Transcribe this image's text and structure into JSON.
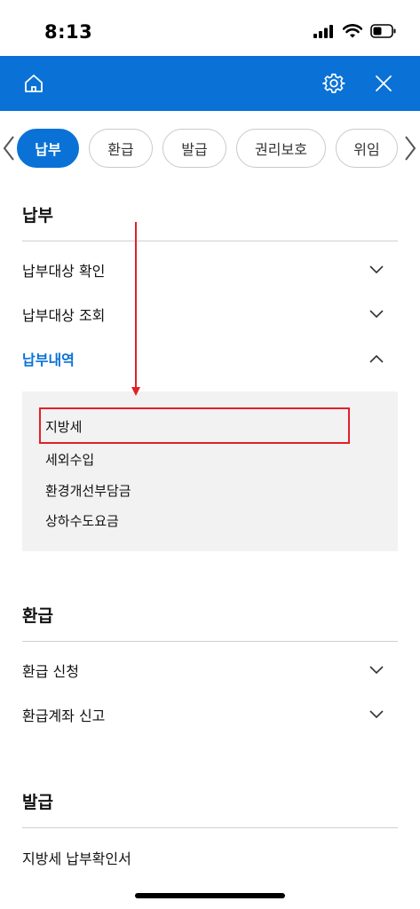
{
  "status_bar": {
    "time": "8:13"
  },
  "header": {
    "home_icon": "home-icon",
    "settings_icon": "gear-icon",
    "close_icon": "close-icon",
    "background_color": "#0a72d6"
  },
  "categories": {
    "items": [
      {
        "label": "납부",
        "active": true
      },
      {
        "label": "환급",
        "active": false
      },
      {
        "label": "발급",
        "active": false
      },
      {
        "label": "권리보호",
        "active": false
      },
      {
        "label": "위임",
        "active": false
      }
    ]
  },
  "sections": {
    "payment": {
      "title": "납부",
      "items": [
        {
          "label": "납부대상 확인",
          "expanded": false
        },
        {
          "label": "납부대상 조회",
          "expanded": false
        },
        {
          "label": "납부내역",
          "expanded": true
        }
      ],
      "submenu": [
        "지방세",
        "세외수입",
        "환경개선부담금",
        "상하수도요금"
      ]
    },
    "refund": {
      "title": "환급",
      "items": [
        {
          "label": "환급 신청",
          "expanded": false
        },
        {
          "label": "환급계좌 신고",
          "expanded": false
        }
      ]
    },
    "issue": {
      "title": "발급",
      "items": [
        {
          "label": "지방세 납부확인서"
        }
      ]
    }
  },
  "annotation": {
    "highlight_color": "#e2202a",
    "highlighted_item": "지방세"
  }
}
